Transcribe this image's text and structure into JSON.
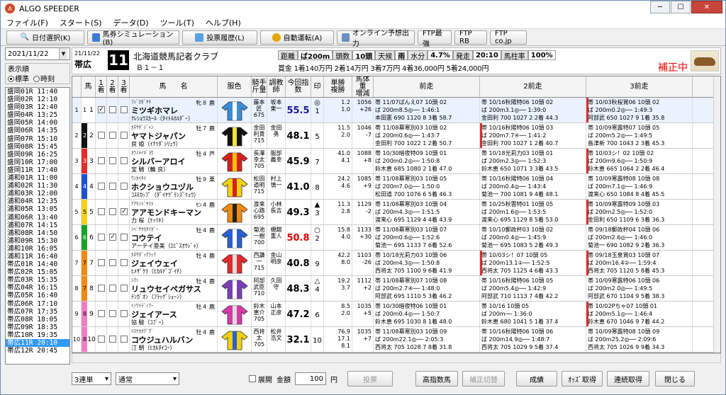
{
  "app": {
    "title": "ALGO SPEEDER"
  },
  "menu": [
    "ファイル(F)",
    "スタート(S)",
    "データ(D)",
    "ツール(T)",
    "ヘルプ(H)"
  ],
  "toolbar": [
    "日付選択(K)",
    "馬券シミュレーション(B)",
    "投票履歴(L)",
    "自動運転(A)",
    "オンライン予想出力",
    "FTP最強",
    "FTP RB",
    "FTP co.jp"
  ],
  "left": {
    "date": "2021/11/22",
    "order_label": "表示順",
    "opt1": "標準",
    "opt2": "時刻",
    "races": [
      "盛岡01R 11:40",
      "盛岡02R 12:10",
      "盛岡03R 12:40",
      "盛岡04R 13:25",
      "盛岡05R 14:00",
      "盛岡06R 14:35",
      "盛岡07R 15:10",
      "盛岡08R 15:45",
      "盛岡09R 16:25",
      "盛岡10R 17:00",
      "盛岡11R 17:40",
      "浦和01R 11:00",
      "浦和02R 11:30",
      "浦和03R 12:00",
      "浦和04R 12:35",
      "浦和05R 13:05",
      "浦和06R 13:40",
      "浦和07R 14:15",
      "浦和08R 14:50",
      "浦和09R 15:30",
      "浦和10R 16:05",
      "浦和11R 16:40",
      "帯広01R 14:40",
      "帯広02R 15:05",
      "帯広03R 15:35",
      "帯広04R 16:15",
      "帯広05R 16:40",
      "帯広06R 17:10",
      "帯広07R 17:35",
      "帯広08R 18:05",
      "帯広09R 18:35",
      "帯広10R 19:35",
      "帯広11R 20:10",
      "帯広12R 20:45"
    ],
    "selected": 32
  },
  "header": {
    "date": "21/11/22",
    "venue": "帯広",
    "race_no": "11",
    "race_name": "北海道競馬記者クラブ",
    "class": "Ｂ１－１",
    "cond": [
      [
        "距離",
        "ば200m"
      ],
      [
        "頭数",
        "10頭"
      ],
      [
        "天候",
        "雨"
      ],
      [
        "水分",
        "4.7%"
      ],
      [
        "発走",
        "20:10"
      ],
      [
        "馬柱率",
        "100%"
      ]
    ],
    "prize": "賞金 1着140万円 2着14万円 3着7万円 4着36,000円 5着24,000円",
    "status": "補正中"
  },
  "columns": {
    "uma": "馬",
    "c1": "1着",
    "c2": "2着",
    "c3": "3着",
    "name": "馬　　名",
    "fuku": "服色",
    "jk": "騎手\n斤量",
    "tr": "調教\n師",
    "shisu": "今回指数",
    "in": "印",
    "od": "単勝\n複勝",
    "bt": "馬体重\n増減",
    "p1": "前走",
    "p2": "2前走",
    "p3": "3前走"
  },
  "horses": [
    {
      "waku": "1",
      "uma": "1",
      "c1": "✓",
      "c2": "",
      "c3": "",
      "fa": "ﾌｼﾞｶｶﾞﾔｷ",
      "sa": "牝８ 鹿",
      "name": "ミツギホマレ",
      "ma": "ｸﾚｼｮｳｽｶｰﾙ（ﾀｲﾄﾙﾎﾙﾀﾞｰ）",
      "jk": "藤本\n匠\n675",
      "tr": "坂本\n東一",
      "shisu": "55.5",
      "shc": "#1a1a9a",
      "in": "◎\n1",
      "od": "1.2\n1.0",
      "bt": "1056\n+26",
      "p1": [
        "帯 11/07ばんえ07 10頭 02",
        "ば 200m8.5◎── 1:46:1",
        "本田憲 690 1120 8 3着 58.7"
      ],
      "p2": [
        "帯 10/16秋陽特06 10頭 02",
        "ば 200m3.1◎── 1:39:0",
        "金田利 700 1027 2 2着 44.3"
      ],
      "p3": [
        "帯 10/03秋桜賞06 10頭 02",
        "ば 200m0.2◎── 1:49:3",
        "阿部武 650 1027 9 1着 35.8"
      ]
    },
    {
      "waku": "2",
      "uma": "2",
      "c1": "",
      "c2": "",
      "c3": "",
      "fa": "ｶﾈｻﾀﾞｼﾞｬﾝ",
      "sa": "牡７ 鹿",
      "name": "ヤマトジャパン",
      "ma": "良 姫（ｲﾅﾘﾀﾞｼﾘｭｳ）",
      "jk": "金田\n利貴\n715",
      "tr": "金田\n勇",
      "shisu": "48.1",
      "shc": "#000",
      "in": "\n5",
      "od": "11.5\n2.0",
      "bt": "1046\n-7",
      "p1": [
        "帯 11/08幕寒別03 10頭 02",
        "ば 200m0.6◎── 1:43:7",
        "金田利 700 1022 1 2着 50.7"
      ],
      "p2": [
        "帯 10/16秋陽特06 10頭 03",
        "ば 200m7.7④── 1:41:2",
        "金田利 700 1027 1 2着 40.7"
      ],
      "p3": [
        "帯 10/09寒露特07 10頭 05",
        "ば 200m5.2◎── 1:49:5",
        "島津新 700 1043 2 3着 45.3"
      ]
    },
    {
      "waku": "3",
      "uma": "3",
      "c1": "",
      "c2": "",
      "c3": "",
      "fa": "ｵﾗﾉﾒｲｷﾞﾖｳ",
      "sa": "牡４ 芦",
      "name": "シルバーアロイ",
      "ma": "宝 騎（輪 良）",
      "jk": "長澤\n幸太\n705",
      "tr": "服部\n義幸",
      "shisu": "45.9",
      "shc": "#000",
      "in": "\n7",
      "od": "41.0\n4.1",
      "bt": "1088\n+8",
      "p1": [
        "帯 10/30暗夜特09 10頭 01",
        "ば 200m0.2◎── 1:50:8",
        "鈴木恵 685 1080 2 1着 47.0"
      ],
      "p2": [
        "帯 10/18光莉力03 10頭 01",
        "ば 200m2.3◎── 1:52:3",
        "鈴木恵 650 1071 3 3着 43.5"
      ],
      "p3": [
        "帯 10/03シ！02 10頭 02",
        "ば 200m9.6◎── 1:50:9",
        "鈴木恵 665 1064 2 2着 46.4"
      ]
    },
    {
      "waku": "4",
      "uma": "4",
      "c1": "",
      "c2": "",
      "c3": "",
      "fa": "ｳﾝｶｲﾀｲ",
      "sa": "牡９ 栗",
      "name": "ホクショウユヅル",
      "ma": "ｺｽﾓｶｯﾌﾟ（ﾀﾞｲﾔｸﾞﾗﾝｽﾞﾘｭｳ）",
      "jk": "松田\n道明\n715",
      "tr": "村上\n慎一",
      "shisu": "41.0",
      "shc": "#000",
      "in": "\n8",
      "od": "24.2\n4.6",
      "bt": "1085\n+9",
      "p1": [
        "帯 11/08幕寒別03 10頭 05",
        "ば 200m7.0◎── 1:50:0",
        "松田道 700 1076 6 5着 46.3"
      ],
      "p2": [
        "帯 10/16秋陽特06 10頭 04",
        "ば 200m0.4◎── 1:43:4",
        "菊池一 700 1081 9 4着 48.1"
      ],
      "p3": [
        "帯 10/09寒露特08 10頭 08",
        "ば 200m7.1◎── 1:46:9",
        "渡来心 650 1084 8 4着 45.5"
      ]
    },
    {
      "waku": "5",
      "uma": "5",
      "c1": "",
      "c2": "",
      "c3": "✓",
      "fa": "ｱｱﾓﾝﾄﾞﾔﾏﾄ",
      "sa": "ｾﾝ４ 鹿",
      "name": "アアモンドキーマン",
      "ma": "力 桜（ｹｯﾘｷ）",
      "jk": "渡来\n心路\n695",
      "tr": "小林\n長吉",
      "shisu": "49.3",
      "shc": "#000",
      "in": "▲\n3",
      "od": "11.3\n2.8",
      "bt": "1129\n-2",
      "p1": [
        "帯 11/08幕寒別03 10頭 04",
        "ば 200m4.3◎── 1:51:5",
        "渡来心 695 1129 4 4着 43.9"
      ],
      "p2": [
        "帯 10/25秋雲特01 10頭 05",
        "ば 200m1.6◎── 1:53:5",
        "渡来心 695 1129 8 5着 53.0"
      ],
      "p3": [
        "帯 10/09寒露特09 10頭 03",
        "ば 200m2.5◎── 1:52:0",
        "金田利 650 1109 6 3着 36.3"
      ]
    },
    {
      "waku": "6",
      "uma": "6",
      "c1": "",
      "c2": "✓",
      "c3": "",
      "fa": "ｼﾍﾞｻﾔｶﾀｲｶﾞｰ",
      "sa": "牡４ 鹿",
      "name": "コウテイ",
      "ma": "アーテイ亜美（ｴﾋﾟｽｵｳｼﾞｬ）",
      "jk": "菊池\n一樹\n700",
      "tr": "槻舘\n重人",
      "shisu": "50.8",
      "shc": "#d00",
      "in": "○\n2",
      "od": "15.8\n4.0",
      "bt": "1133\n+30",
      "p1": [
        "帯 11/08幕寒別03 10頭 07",
        "ば 200m0.6◎── 1:52:6",
        "菊池一 695 1133 7 6着 52.6"
      ],
      "p2": [
        "帯 10/10郵政杯03 10頭 02",
        "ば 200m0.4◎── 1:45:9",
        "菊池一 695 1083 5 2着 49.3"
      ],
      "p3": [
        "帯 09/18郵政杯04 10頭 06",
        "ば 200m2.6◎── 1:46:0",
        "菊池一 690 1082 9 2着 36.3"
      ]
    },
    {
      "waku": "7",
      "uma": "7",
      "c1": "",
      "c2": "",
      "c3": "",
      "fa": "ｶﾈｻﾀﾞｯｸﾗｯｸ",
      "sa": "牡４ 鹿",
      "name": "ジェイウェイ",
      "ma": "ﾋﾒｻﾞｸﾗ（ﾋｶﾙﾃﾞｺﾞｲﾁ）",
      "jk": "西謙\n一\n715",
      "tr": "金山\n明彦",
      "shisu": "40.8",
      "shc": "#000",
      "in": "\n9",
      "od": "42.2\n8.0",
      "bt": "1103\n-26",
      "p1": [
        "帯 10/18光莉力03 10頭 06",
        "ば 200m4.3◎── 1:50:8",
        "西将太 705 1100 9 6着 41.9"
      ],
      "p2": [
        "帯 10/03シ！07 10頭 05",
        "ば 200m13.1②── 1:52:5",
        "西将太 705 1125 4 6着 43.3"
      ],
      "p3": [
        "帯 09/18玉泉賞03 10頭 07",
        "ば 200m16.4②── 1:59:4",
        "西将太 705 1120 5 8着 45.3"
      ]
    },
    {
      "waku": "7",
      "uma": "8",
      "c1": "",
      "c2": "",
      "c3": "",
      "fa": "ｼｳﾝ",
      "sa": "牡４ 鹿",
      "name": "リュウセイペガサス",
      "ma": "ﾃﾝｶﾞｵﾝ（ﾌﾗｯｸﾞｼｮｰﾝ）",
      "jk": "阿部\n武臣\n710",
      "tr": "久田\n守",
      "shisu": "48.3",
      "shc": "#000",
      "in": "△\n4",
      "od": "19.2\n3.7",
      "bt": "1112\n+2",
      "p1": [
        "帯 11/08幕寒別07 10頭 08",
        "ば 200m2.7④── 1:48:0",
        "阿部武 695 1110 5 3着 46.2"
      ],
      "p2": [
        "帯 10/16秋陽特06 10頭 05",
        "ば 200m5.4◎── 1:42:9",
        "阿部武 710 1113 7 4着 42.2"
      ],
      "p3": [
        "帯 10/09寒露特06 10頭 06",
        "ば 200m2.0◎── 1:49:5",
        "阿部武 670 1104 9 5着 38.3"
      ]
    },
    {
      "waku": "8",
      "uma": "9",
      "c1": "",
      "c2": "",
      "c3": "",
      "fa": "ｲﾉﾜｲﾃﾞｨｱｰ",
      "sa": "牡４ 鹿",
      "name": "ジェイアース",
      "ma": "協 駿（ｺﾌﾞｰ）",
      "jk": "鈴木\n恵介\n705",
      "tr": "山本\n正彦",
      "shisu": "47.2",
      "shc": "#000",
      "in": "\n6",
      "od": "8.5\n2.0",
      "bt": "1035\n+5",
      "p1": [
        "帯 10/30暗夜特06 10頭 01",
        "ば 200m0.4◎── 1:50:7",
        "鈴木恵 695 1030 8 1着 48.0"
      ],
      "p2": [
        "帯 10/16 10頭 05",
        "ば 200m── 1:36:0",
        "鈴木恵 680 1041 5 1着 37.4"
      ],
      "p3": [
        "帯 10/02Pちゃ07 10頭 01",
        "ば 200m5.1◎── 1:46:4",
        "鈴木恵 670 1046 9 7着 44.2"
      ]
    },
    {
      "waku": "8",
      "uma": "10",
      "c1": "",
      "c2": "",
      "c3": "",
      "fa": "ﾊﾏﾅｶｵｸﾞｳﾞ",
      "sa": "牡４ 鹿",
      "name": "コウジュハルバン",
      "ma": "汀 朝（ﾋｶﾙﾀｲｺｰ）",
      "jk": "西将\n太\n705",
      "tr": "松井\n浩文",
      "shisu": "32.1",
      "shc": "#000",
      "in": "\n10",
      "od": "76.9\n17.1\n8.1",
      "bt": "1035\n+7",
      "p1": [
        "帯 11/08幕寒別03 10頭 09",
        "ば 200m22.1◎── 2:05:3",
        "西将太 705 1028 7 8着 31.8"
      ],
      "p2": [
        "帯 10/16秋陽特06 10頭 06",
        "ば 200m14.9◎── 1:48:7",
        "西将太 705 1029 9 5着 37.4"
      ],
      "p3": [
        "帯 10/09寒露特08 10頭 09",
        "ば 200m25.2◎── 2:09:6",
        "西将太 705 1026 9 9着 34.3"
      ]
    }
  ],
  "bottom": {
    "bet_type": "3連単",
    "mode": "通常",
    "tenkai": "展開",
    "kingaku_label": "金額",
    "kingaku": "100",
    "yen": "円",
    "vote": "投票",
    "kou": "高指数馬",
    "hosei": "補正切替",
    "seiseki": "成績",
    "odds": "ｵｯｽﾞ取得",
    "renzoku": "連続取得",
    "close": "閉じる"
  },
  "waku_colors": [
    "#ffffff",
    "#111111",
    "#e52a2a",
    "#1f4fd6",
    "#f3d21a",
    "#17a12a",
    "#f28a10",
    "#ef7fc4"
  ]
}
